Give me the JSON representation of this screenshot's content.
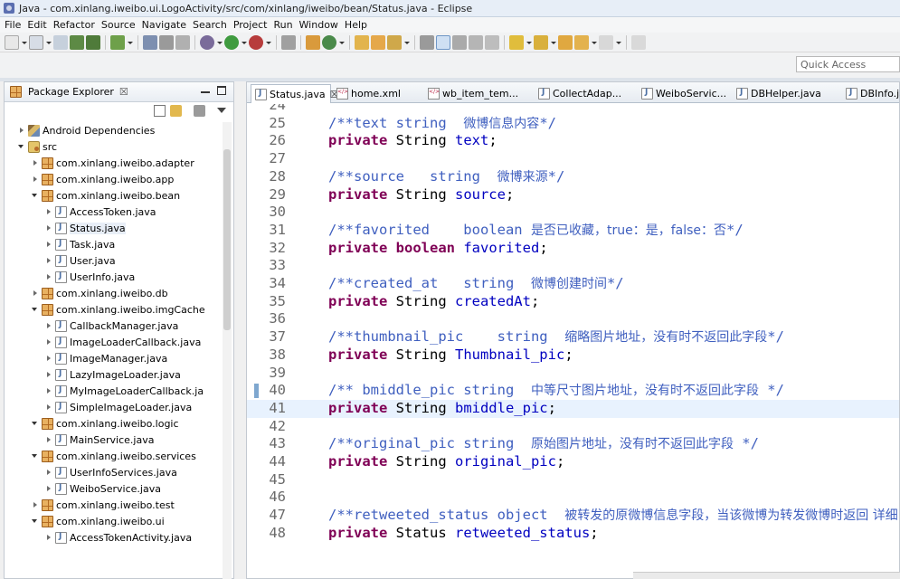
{
  "window": {
    "title": "Java - com.xinlang.iweibo.ui.LogoActivity/src/com/xinlang/iweibo/bean/Status.java - Eclipse"
  },
  "menu": [
    "File",
    "Edit",
    "Refactor",
    "Source",
    "Navigate",
    "Search",
    "Project",
    "Run",
    "Window",
    "Help"
  ],
  "quick_access": {
    "placeholder": "Quick Access"
  },
  "package_explorer": {
    "title": "Package Explorer",
    "close": "☒",
    "tree": [
      {
        "label": "Android Dependencies",
        "icon": "library-icon",
        "arrow": "closed",
        "indent": 1
      },
      {
        "label": "src",
        "icon": "source-folder-icon",
        "arrow": "open",
        "indent": 1
      },
      {
        "label": "com.xinlang.iweibo.adapter",
        "icon": "package-icon",
        "arrow": "closed",
        "indent": 2
      },
      {
        "label": "com.xinlang.iweibo.app",
        "icon": "package-icon",
        "arrow": "closed",
        "indent": 2
      },
      {
        "label": "com.xinlang.iweibo.bean",
        "icon": "package-icon",
        "arrow": "open",
        "indent": 2
      },
      {
        "label": "AccessToken.java",
        "icon": "java-file-icon",
        "arrow": "closed",
        "indent": 3
      },
      {
        "label": "Status.java",
        "icon": "java-file-icon",
        "arrow": "closed",
        "indent": 3,
        "selected": true
      },
      {
        "label": "Task.java",
        "icon": "java-file-icon",
        "arrow": "closed",
        "indent": 3
      },
      {
        "label": "User.java",
        "icon": "java-file-icon",
        "arrow": "closed",
        "indent": 3
      },
      {
        "label": "UserInfo.java",
        "icon": "java-file-icon",
        "arrow": "closed",
        "indent": 3
      },
      {
        "label": "com.xinlang.iweibo.db",
        "icon": "package-icon",
        "arrow": "closed",
        "indent": 2
      },
      {
        "label": "com.xinlang.iweibo.imgCache",
        "icon": "package-icon",
        "arrow": "open",
        "indent": 2
      },
      {
        "label": "CallbackManager.java",
        "icon": "java-file-icon",
        "arrow": "closed",
        "indent": 3
      },
      {
        "label": "ImageLoaderCallback.java",
        "icon": "java-file-icon",
        "arrow": "closed",
        "indent": 3
      },
      {
        "label": "ImageManager.java",
        "icon": "java-file-icon",
        "arrow": "closed",
        "indent": 3
      },
      {
        "label": "LazyImageLoader.java",
        "icon": "java-file-icon",
        "arrow": "closed",
        "indent": 3
      },
      {
        "label": "MyImageLoaderCallback.ja",
        "icon": "java-file-icon",
        "arrow": "closed",
        "indent": 3
      },
      {
        "label": "SimpleImageLoader.java",
        "icon": "java-file-icon",
        "arrow": "closed",
        "indent": 3
      },
      {
        "label": "com.xinlang.iweibo.logic",
        "icon": "package-icon",
        "arrow": "open",
        "indent": 2
      },
      {
        "label": "MainService.java",
        "icon": "java-file-icon",
        "arrow": "closed",
        "indent": 3
      },
      {
        "label": "com.xinlang.iweibo.services",
        "icon": "package-icon",
        "arrow": "open",
        "indent": 2
      },
      {
        "label": "UserInfoServices.java",
        "icon": "java-file-icon",
        "arrow": "closed",
        "indent": 3
      },
      {
        "label": "WeiboService.java",
        "icon": "java-file-icon",
        "arrow": "closed",
        "indent": 3
      },
      {
        "label": "com.xinlang.iweibo.test",
        "icon": "package-icon",
        "arrow": "closed",
        "indent": 2
      },
      {
        "label": "com.xinlang.iweibo.ui",
        "icon": "package-icon",
        "arrow": "open",
        "indent": 2
      },
      {
        "label": "AccessTokenActivity.java",
        "icon": "java-file-icon",
        "arrow": "closed",
        "indent": 3
      }
    ]
  },
  "editor": {
    "tabs": [
      {
        "label": "Status.java",
        "icon": "java-file-icon",
        "active": true,
        "close": "☒"
      },
      {
        "label": "home.xml",
        "icon": "xml-file-icon"
      },
      {
        "label": "wb_item_tem...",
        "icon": "xml-file-icon"
      },
      {
        "label": "CollectAdap...",
        "icon": "java-file-icon"
      },
      {
        "label": "WeiboServic...",
        "icon": "java-file-icon"
      },
      {
        "label": "DBHelper.java",
        "icon": "java-file-icon"
      },
      {
        "label": "DBInfo.java",
        "icon": "java-file-icon"
      }
    ],
    "lines": [
      {
        "n": "24",
        "parts": []
      },
      {
        "n": "25",
        "parts": [
          [
            "cm",
            "/**text string  "
          ],
          [
            "cmz",
            "微博信息内容"
          ],
          [
            "cm",
            "*/"
          ]
        ]
      },
      {
        "n": "26",
        "parts": [
          [
            "kw",
            "private"
          ],
          [
            "",
            " String "
          ],
          [
            "fld",
            "text"
          ],
          [
            "",
            ";"
          ]
        ]
      },
      {
        "n": "27",
        "parts": []
      },
      {
        "n": "28",
        "parts": [
          [
            "cm",
            "/**source   string  "
          ],
          [
            "cmz",
            "微博来源"
          ],
          [
            "cm",
            "*/"
          ]
        ]
      },
      {
        "n": "29",
        "parts": [
          [
            "kw",
            "private"
          ],
          [
            "",
            " String "
          ],
          [
            "fld",
            "source"
          ],
          [
            "",
            ";"
          ]
        ]
      },
      {
        "n": "30",
        "parts": []
      },
      {
        "n": "31",
        "parts": [
          [
            "cm",
            "/**favorited    boolean "
          ],
          [
            "cmz",
            "是否已收藏，true：是，false：否"
          ],
          [
            "cm",
            "*/"
          ]
        ]
      },
      {
        "n": "32",
        "parts": [
          [
            "kw",
            "private"
          ],
          [
            "",
            " "
          ],
          [
            "kw",
            "boolean"
          ],
          [
            "",
            " "
          ],
          [
            "fld",
            "favorited"
          ],
          [
            "",
            ";"
          ]
        ]
      },
      {
        "n": "33",
        "parts": []
      },
      {
        "n": "34",
        "parts": [
          [
            "cm",
            "/**created_at   string  "
          ],
          [
            "cmz",
            "微博创建时间"
          ],
          [
            "cm",
            "*/"
          ]
        ]
      },
      {
        "n": "35",
        "parts": [
          [
            "kw",
            "private"
          ],
          [
            "",
            " String "
          ],
          [
            "fld",
            "createdAt"
          ],
          [
            "",
            ";"
          ]
        ]
      },
      {
        "n": "36",
        "parts": []
      },
      {
        "n": "37",
        "parts": [
          [
            "cm",
            "/**thumbnail_pic    string  "
          ],
          [
            "cmz",
            "缩略图片地址，没有时不返回此字段"
          ],
          [
            "cm",
            "*/"
          ]
        ]
      },
      {
        "n": "38",
        "parts": [
          [
            "kw",
            "private"
          ],
          [
            "",
            " String "
          ],
          [
            "fld",
            "Thumbnail_pic"
          ],
          [
            "",
            ";"
          ]
        ]
      },
      {
        "n": "39",
        "parts": []
      },
      {
        "n": "40",
        "parts": [
          [
            "cm",
            "/** bmiddle_pic string  "
          ],
          [
            "cmz",
            "中等尺寸图片地址，没有时不返回此字段"
          ],
          [
            "cm",
            " */"
          ]
        ],
        "mark": true
      },
      {
        "n": "41",
        "parts": [
          [
            "kw",
            "private"
          ],
          [
            "",
            " String "
          ],
          [
            "fld",
            "bmiddle_pic"
          ],
          [
            "",
            ";"
          ]
        ],
        "current": true,
        "mark": true
      },
      {
        "n": "42",
        "parts": []
      },
      {
        "n": "43",
        "parts": [
          [
            "cm",
            "/**original_pic string  "
          ],
          [
            "cmz",
            "原始图片地址，没有时不返回此字段"
          ],
          [
            "cm",
            " */"
          ]
        ]
      },
      {
        "n": "44",
        "parts": [
          [
            "kw",
            "private"
          ],
          [
            "",
            " String "
          ],
          [
            "fld",
            "original_pic"
          ],
          [
            "",
            ";"
          ]
        ]
      },
      {
        "n": "45",
        "parts": []
      },
      {
        "n": "46",
        "parts": []
      },
      {
        "n": "47",
        "parts": [
          [
            "cm",
            "/**retweeted_status object  "
          ],
          [
            "cmz",
            "被转发的原微博信息字段，当该微博为转发微博时返回 详细"
          ],
          [
            "cm",
            "*/"
          ]
        ]
      },
      {
        "n": "48",
        "parts": [
          [
            "kw",
            "private"
          ],
          [
            "",
            " Status "
          ],
          [
            "fld",
            "retweeted_status"
          ],
          [
            "",
            ";"
          ]
        ]
      }
    ]
  }
}
